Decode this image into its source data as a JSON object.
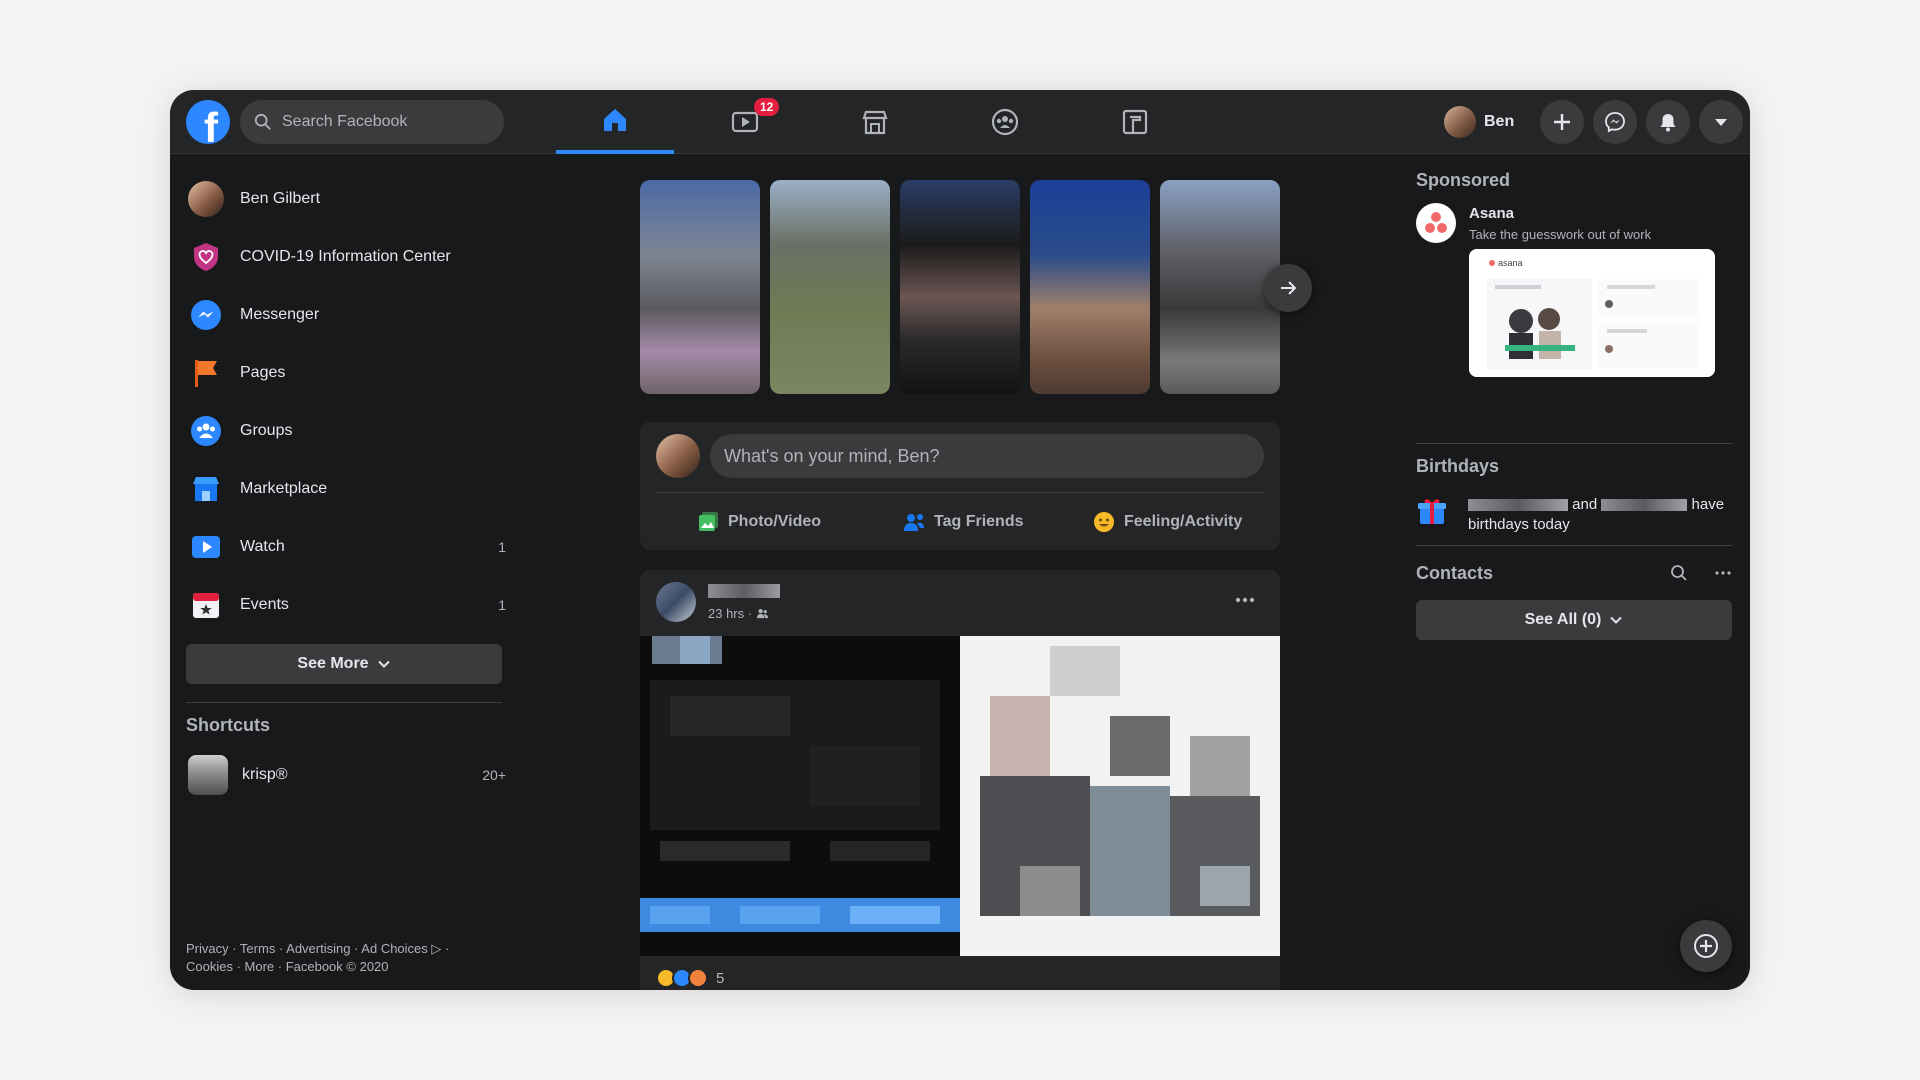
{
  "topbar": {
    "search_placeholder": "Search Facebook",
    "watch_badge": "12",
    "profile_name": "Ben"
  },
  "sidebar": {
    "items": [
      {
        "label": "Ben Gilbert",
        "count": ""
      },
      {
        "label": "COVID-19 Information Center",
        "count": ""
      },
      {
        "label": "Messenger",
        "count": ""
      },
      {
        "label": "Pages",
        "count": ""
      },
      {
        "label": "Groups",
        "count": ""
      },
      {
        "label": "Marketplace",
        "count": ""
      },
      {
        "label": "Watch",
        "count": "1"
      },
      {
        "label": "Events",
        "count": "1"
      }
    ],
    "see_more": "See More",
    "shortcuts_title": "Shortcuts",
    "shortcuts": [
      {
        "label": "krisp®",
        "count": "20+"
      }
    ],
    "footer_line1": "Privacy · Terms · Advertising · Ad Choices ▷ ·",
    "footer_line2": "Cookies · More · Facebook © 2020"
  },
  "composer": {
    "placeholder": "What's on your mind, Ben?",
    "actions": [
      "Photo/Video",
      "Tag Friends",
      "Feeling/Activity"
    ]
  },
  "post": {
    "time": "23 hrs ·",
    "reaction_count": "5"
  },
  "right": {
    "sponsored_title": "Sponsored",
    "ad_name": "Asana",
    "ad_tagline": "Take the guesswork out of work",
    "ad_image_brand": "asana",
    "birthdays_title": "Birthdays",
    "birthday_and": "and",
    "birthday_suffix": "have birthdays today",
    "contacts_title": "Contacts",
    "see_all": "See All (0)"
  },
  "colors": {
    "accent": "#2d88ff",
    "badge": "#e41e3f",
    "background": "#18191a",
    "surface": "#242526"
  }
}
